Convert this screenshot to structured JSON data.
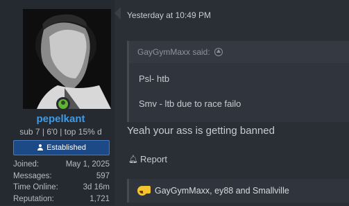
{
  "user": {
    "name": "pepelkant",
    "title": "sub 7 | 6'0 | top 15% d",
    "banner": "Established",
    "stats": [
      {
        "key": "Joined:",
        "value": "May 1, 2025"
      },
      {
        "key": "Messages:",
        "value": "597"
      },
      {
        "key": "Time Online:",
        "value": "3d 16m"
      },
      {
        "key": "Reputation:",
        "value": "1,721"
      }
    ],
    "online": true
  },
  "post": {
    "timestamp": "Yesterday at 10:49 PM",
    "quote": {
      "author": "GayGymMaxx said:",
      "lines": [
        "Psl- htb",
        "Smv - ltb due to race failo"
      ]
    },
    "body": "Yeah your ass is getting banned",
    "report_label": "Report",
    "reactions": "GayGymMaxx, ey88 and Smallville"
  },
  "colors": {
    "username": "#3d9be9",
    "banner_bg": "#1c4a86",
    "online": "#63b337"
  }
}
